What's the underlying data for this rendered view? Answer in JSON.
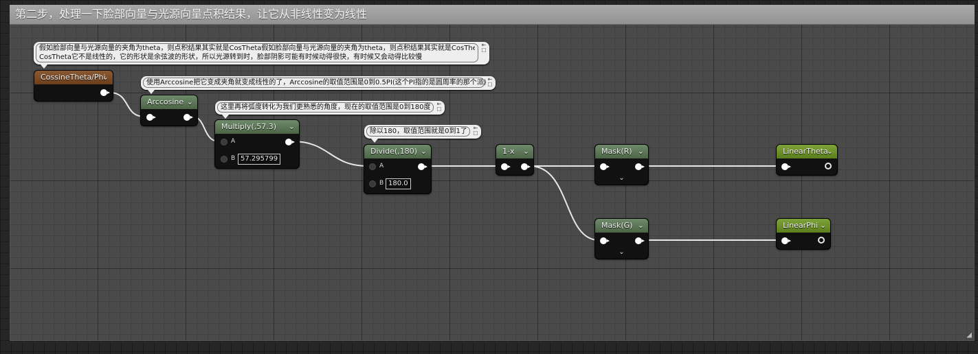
{
  "comment_box": {
    "title": "第二步，处理一下脸部向量与光源向量点积结果，让它从非线性变为线性"
  },
  "bubbles": {
    "cossine": {
      "line1": "假如脸部向量与光源向量的夹角为theta，则点积结果其实就是CosTheta假如脸部向量与光源向量的夹角为theta，则点积结果其实就是CosTheta",
      "line2": "CosTheta它不是线性的，它的形状是余弦波的形状，所以光源转到时，脸部阴影可能有时候动得很快，有时候又会动得比较慢"
    },
    "arccosine": "使用Arccosine把它变成夹角就变成线性的了，Arccosine的取值范围是0到0.5PI(这个PI指的是圆周率的那个派)",
    "multiply": "这里再将弧度转化为我们更熟悉的角度，现在的取值范围是0到180度",
    "divide": "除以180，取值范围就是0到1了"
  },
  "nodes": {
    "cossine": {
      "title": "CossineTheta/Phi"
    },
    "arccosine": {
      "title": "Arccosine"
    },
    "multiply": {
      "title": "Multiply(,57.3)",
      "pin_a": "A",
      "pin_b": "B",
      "b_value": "57.295799"
    },
    "divide": {
      "title": "Divide(,180)",
      "pin_a": "A",
      "pin_b": "B",
      "b_value": "180.0"
    },
    "oneminus": {
      "title": "1-x"
    },
    "mask_r": {
      "title": "Mask(R)"
    },
    "mask_g": {
      "title": "Mask(G)"
    },
    "linear_theta": {
      "title": "LinearTheta"
    },
    "linear_phi": {
      "title": "LinearPhi"
    }
  },
  "colors": {
    "header_brown": "#6b3f1d",
    "header_green": "#4c6547",
    "header_lime": "#5b7d1c",
    "comment_header": "#9c9c9c",
    "wire": "#e8e8e8"
  }
}
